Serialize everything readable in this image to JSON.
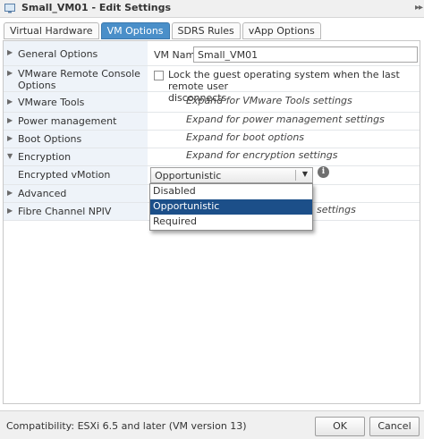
{
  "window": {
    "title": "Small_VM01 - Edit Settings"
  },
  "tabs": [
    {
      "label": "Virtual Hardware"
    },
    {
      "label": "VM Options"
    },
    {
      "label": "SDRS Rules"
    },
    {
      "label": "vApp Options"
    }
  ],
  "rows": {
    "general_options": {
      "label": "General Options",
      "vm_name_label": "VM Name:",
      "vm_name_value": "Small_VM01"
    },
    "remote_console": {
      "label_line1": "VMware Remote Console",
      "label_line2": "Options",
      "checkbox_line1": "Lock the guest operating system when the last remote user",
      "checkbox_line2": "disconnects"
    },
    "vmware_tools": {
      "label": "VMware Tools",
      "hint": "Expand for VMware Tools settings"
    },
    "power_management": {
      "label": "Power management",
      "hint": "Expand for power management settings"
    },
    "boot_options": {
      "label": "Boot Options",
      "hint": "Expand for boot options"
    },
    "encryption": {
      "label": "Encryption",
      "hint": "Expand for encryption settings"
    },
    "encrypted_vmotion": {
      "label": "Encrypted vMotion",
      "selected": "Opportunistic"
    },
    "advanced": {
      "label": "Advanced"
    },
    "fibre_channel": {
      "label": "Fibre Channel NPIV",
      "hint_partial": "settings"
    }
  },
  "dropdown": {
    "options": [
      "Disabled",
      "Opportunistic",
      "Required"
    ],
    "selected": "Opportunistic"
  },
  "footer": {
    "compatibility": "Compatibility: ESXi 6.5 and later (VM version 13)",
    "ok_label": "OK",
    "cancel_label": "Cancel"
  },
  "colors": {
    "active_tab": "#4a8fc9",
    "selected_option": "#1c4f89",
    "label_column": "#eef3f9"
  }
}
